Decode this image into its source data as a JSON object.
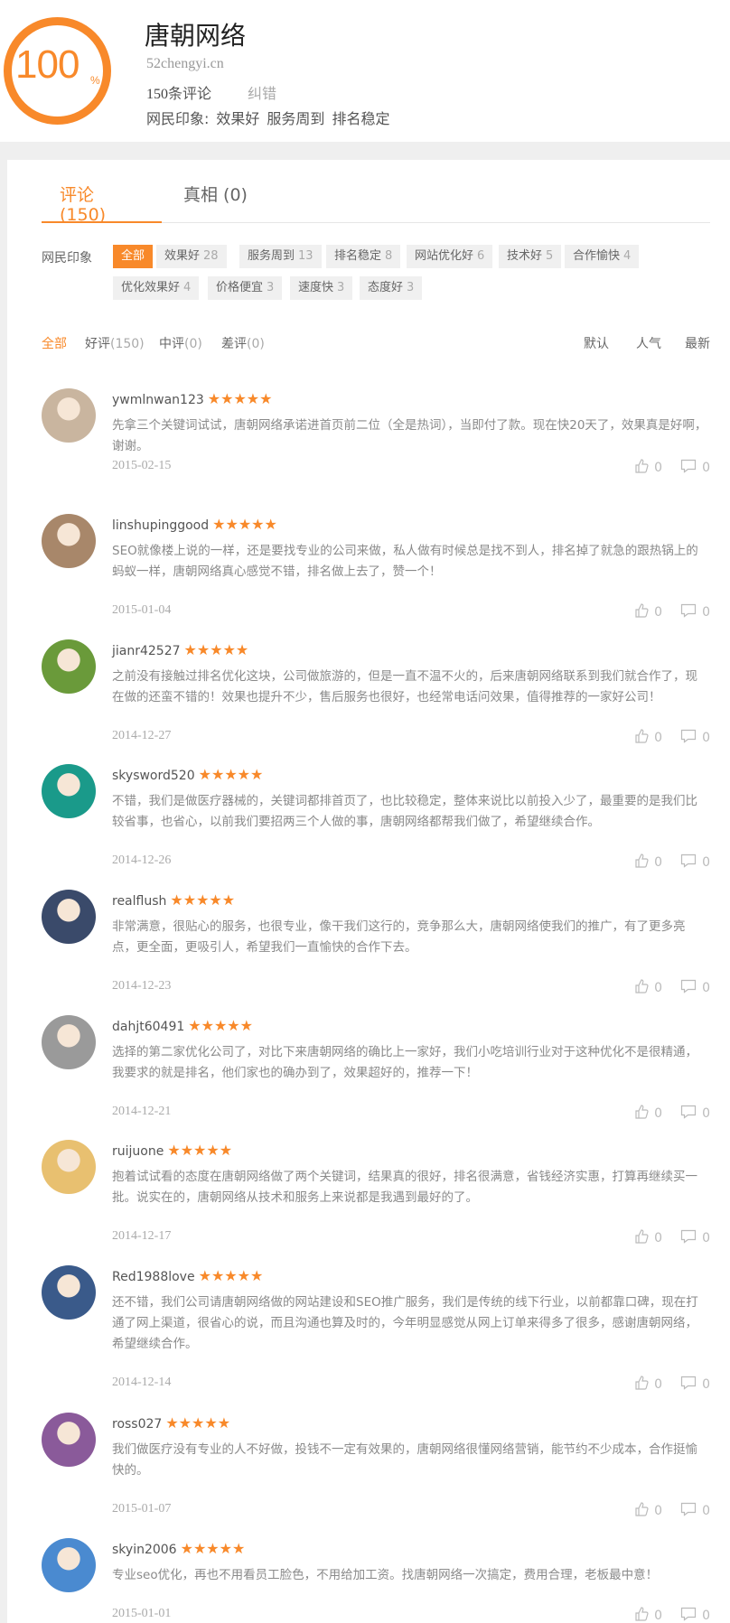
{
  "header": {
    "score": "100",
    "score_unit": "%",
    "company": "唐朝网络",
    "domain": "52chengyi.cn",
    "comment_count": "150",
    "comment_suffix": "条评论",
    "report": "纠错",
    "impression_label": "网民印象:",
    "impressions": [
      "效果好",
      "服务周到",
      "排名稳定"
    ]
  },
  "tabs": [
    {
      "label": "评论 (150)"
    },
    {
      "label": "真相 (0)"
    }
  ],
  "impression_label": "网民印象",
  "tags": [
    {
      "label": "全部",
      "count": ""
    },
    {
      "label": "效果好",
      "count": "28"
    },
    {
      "label": "服务周到",
      "count": "13"
    },
    {
      "label": "排名稳定",
      "count": "8"
    },
    {
      "label": "网站优化好",
      "count": "6"
    },
    {
      "label": "技术好",
      "count": "5"
    },
    {
      "label": "合作愉快",
      "count": "4"
    },
    {
      "label": "优化效果好",
      "count": "4"
    },
    {
      "label": "价格便宜",
      "count": "3"
    },
    {
      "label": "速度快",
      "count": "3"
    },
    {
      "label": "态度好",
      "count": "3"
    }
  ],
  "filters": [
    {
      "label": "全部",
      "count": ""
    },
    {
      "label": "好评",
      "count": "(150)"
    },
    {
      "label": "中评",
      "count": "(0)"
    },
    {
      "label": "差评",
      "count": "(0)"
    }
  ],
  "sorts": [
    "默认",
    "人气",
    "最新"
  ],
  "stars": "★★★★★",
  "reviews": [
    {
      "user": "ywmlnwan123",
      "text": "先拿三个关键词试试，唐朝网络承诺进首页前二位（全是热词），当即付了款。现在快20天了，效果真是好啊，谢谢。",
      "date": "2015-02-15",
      "likes": "0",
      "comments": "0",
      "avatar_color": "#c9b59f"
    },
    {
      "user": "linshupinggood",
      "text": "SEO就像楼上说的一样，还是要找专业的公司来做，私人做有时候总是找不到人，排名掉了就急的跟热锅上的蚂蚁一样，唐朝网络真心感觉不错，排名做上去了，赞一个！",
      "date": "2015-01-04",
      "likes": "0",
      "comments": "0",
      "avatar_color": "#a8876a"
    },
    {
      "user": "jianr42527",
      "text": "之前没有接触过排名优化这块，公司做旅游的，但是一直不温不火的，后来唐朝网络联系到我们就合作了，现在做的还蛮不错的！效果也提升不少，售后服务也很好，也经常电话问效果，值得推荐的一家好公司！",
      "date": "2014-12-27",
      "likes": "0",
      "comments": "0",
      "avatar_color": "#6a9a3a"
    },
    {
      "user": "skysword520",
      "text": "不错，我们是做医疗器械的，关键词都排首页了，也比较稳定，整体来说比以前投入少了，最重要的是我们比较省事，也省心，以前我们要招两三个人做的事，唐朝网络都帮我们做了，希望继续合作。",
      "date": "2014-12-26",
      "likes": "0",
      "comments": "0",
      "avatar_color": "#1a9a8a"
    },
    {
      "user": "realflush",
      "text": "非常满意，很贴心的服务，也很专业，像干我们这行的，竞争那么大，唐朝网络使我们的推广，有了更多亮点，更全面，更吸引人，希望我们一直愉快的合作下去。",
      "date": "2014-12-23",
      "likes": "0",
      "comments": "0",
      "avatar_color": "#3a4a6a"
    },
    {
      "user": "dahjt60491",
      "text": "选择的第二家优化公司了，对比下来唐朝网络的确比上一家好，我们小吃培训行业对于这种优化不是很精通，我要求的就是排名，他们家也的确办到了，效果超好的，推荐一下！",
      "date": "2014-12-21",
      "likes": "0",
      "comments": "0",
      "avatar_color": "#9a9a9a"
    },
    {
      "user": "ruijuone",
      "text": "抱着试试看的态度在唐朝网络做了两个关键词，结果真的很好，排名很满意，省钱经济实惠，打算再继续买一批。说实在的，唐朝网络从技术和服务上来说都是我遇到最好的了。",
      "date": "2014-12-17",
      "likes": "0",
      "comments": "0",
      "avatar_color": "#e8c070"
    },
    {
      "user": "Red1988love",
      "text": "还不错，我们公司请唐朝网络做的网站建设和SEO推广服务，我们是传统的线下行业，以前都靠口碑，现在打通了网上渠道，很省心的说，而且沟通也算及时的，今年明显感觉从网上订单来得多了很多，感谢唐朝网络，希望继续合作。",
      "date": "2014-12-14",
      "likes": "0",
      "comments": "0",
      "avatar_color": "#3a5a8a"
    },
    {
      "user": "ross027",
      "text": "我们做医疗没有专业的人不好做，投钱不一定有效果的，唐朝网络很懂网络营销，能节约不少成本，合作挺愉快的。",
      "date": "2015-01-07",
      "likes": "0",
      "comments": "0",
      "avatar_color": "#8a5a9a"
    },
    {
      "user": "skyin2006",
      "text": "专业seo优化，再也不用看员工脸色，不用给加工资。找唐朝网络一次搞定，费用合理，老板最中意！",
      "date": "2015-01-01",
      "likes": "0",
      "comments": "0",
      "avatar_color": "#4a8ad0"
    }
  ]
}
